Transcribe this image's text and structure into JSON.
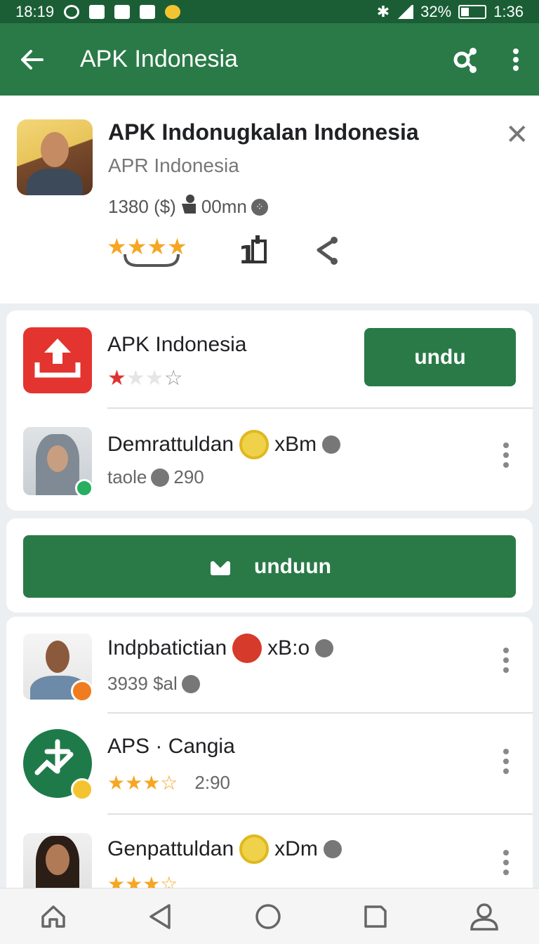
{
  "status_bar": {
    "time_left": "18:19",
    "battery": "32%",
    "time_right": "1:36"
  },
  "app_bar": {
    "title": "APK Indonesia"
  },
  "header": {
    "title": "APK Indonugkalan Indonesia",
    "subtitle": "APR Indonesia",
    "meta": "1380 ($)",
    "meta2": "00mn"
  },
  "card1": {
    "app_title": "APK Indonesia",
    "install_button": "undu",
    "user_name": "Demrattuldan",
    "user_tag": "xBm",
    "user_sub": "taole",
    "user_count": "290"
  },
  "download_button": {
    "label": "unduun"
  },
  "list": [
    {
      "name": "Indpbatictian",
      "tag": "xB:o",
      "sub": "3939 $al",
      "badge_color": "#f07c1f"
    },
    {
      "name": "APS · Cangia",
      "sub": "2:90",
      "stars": "★★★☆"
    },
    {
      "name": "Genpattuldan",
      "tag": "xDm",
      "stars": "★★★☆"
    }
  ]
}
